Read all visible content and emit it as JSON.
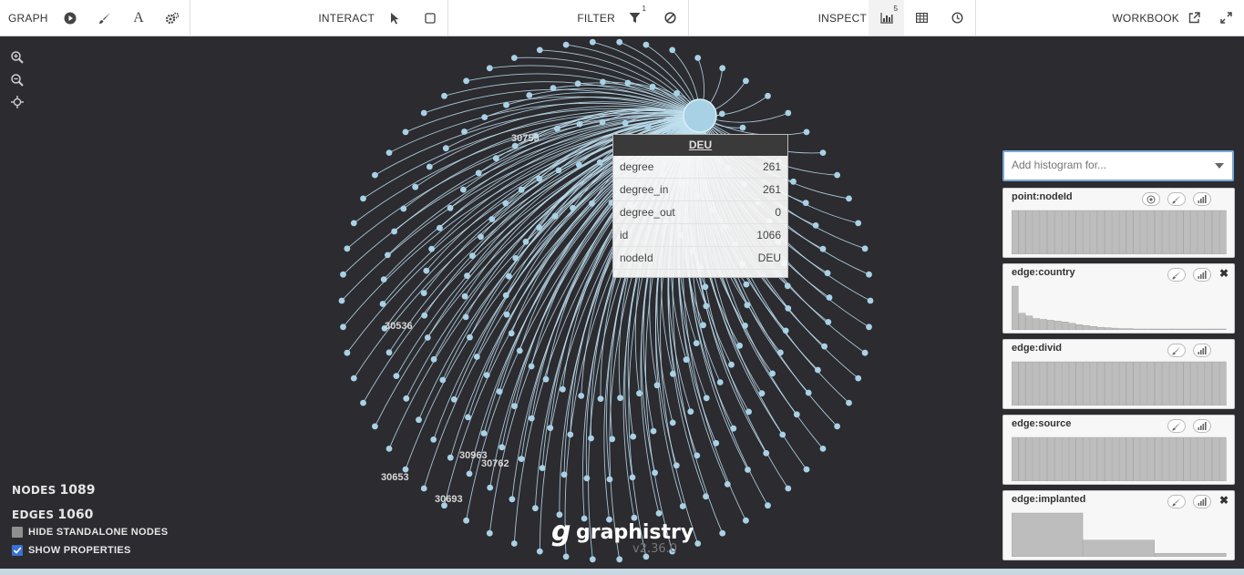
{
  "toolbar": {
    "graph_label": "GRAPH",
    "interact_label": "INTERACT",
    "filter_label": "FILTER",
    "filter_count": "1",
    "inspect_label": "INSPECT",
    "inspect_count": "5",
    "workbook_label": "WORKBOOK"
  },
  "graph": {
    "node_color": "#a9d1e6",
    "edge_color": "#bfe0f0",
    "hub_label": "DEU",
    "visible_labels": [
      "30755",
      "30536",
      "30963",
      "30762",
      "30653",
      "30693"
    ]
  },
  "tooltip": {
    "title": "DEU",
    "rows": [
      {
        "key": "degree",
        "value": "261"
      },
      {
        "key": "degree_in",
        "value": "261"
      },
      {
        "key": "degree_out",
        "value": "0"
      },
      {
        "key": "id",
        "value": "1066"
      },
      {
        "key": "nodeId",
        "value": "DEU"
      }
    ]
  },
  "stats": {
    "nodes_label": "NODES",
    "nodes_value": "1089",
    "edges_label": "EDGES",
    "edges_value": "1060",
    "hide_standalone_label": "HIDE STANDALONE NODES",
    "hide_standalone_checked": false,
    "show_properties_label": "SHOW PROPERTIES",
    "show_properties_checked": true
  },
  "logo": {
    "name": "graphistry",
    "version": "v2.36.0"
  },
  "histograms": {
    "placeholder": "Add histogram for...",
    "cards": [
      {
        "title": "point:nodeId",
        "closable": false,
        "shape": [
          1,
          1,
          1,
          1,
          1,
          1,
          1,
          1,
          1,
          1,
          1,
          1,
          1,
          1,
          1,
          1,
          1,
          1,
          1,
          1,
          1,
          1,
          1,
          1,
          1,
          1,
          1,
          1,
          1,
          1
        ]
      },
      {
        "title": "edge:country",
        "closable": true,
        "shape": [
          1,
          0.38,
          0.32,
          0.26,
          0.24,
          0.22,
          0.2,
          0.18,
          0.15,
          0.12,
          0.1,
          0.08,
          0.06,
          0.05,
          0.04,
          0.03,
          0.03,
          0.02,
          0.02,
          0.02,
          0.02,
          0.02,
          0.02,
          0.02,
          0.02,
          0.02,
          0.02,
          0.02,
          0.02,
          0.02
        ]
      },
      {
        "title": "edge:divid",
        "closable": false,
        "shape": [
          1,
          1,
          1,
          1,
          1,
          1,
          1,
          1,
          1,
          1,
          1,
          1,
          1,
          1,
          1,
          1,
          1,
          1,
          1,
          1,
          1,
          1,
          1,
          1,
          1,
          1,
          1,
          1,
          1,
          1
        ]
      },
      {
        "title": "edge:source",
        "closable": false,
        "shape": [
          1,
          1,
          1,
          1,
          1,
          1,
          1,
          1,
          1,
          1,
          1,
          1,
          1,
          1,
          1,
          1,
          1,
          1,
          1,
          1,
          1,
          1,
          1,
          1,
          1,
          1,
          1,
          1,
          1,
          1
        ]
      },
      {
        "title": "edge:implanted",
        "closable": true,
        "shape": [
          1,
          0.38,
          0.08
        ]
      }
    ]
  }
}
